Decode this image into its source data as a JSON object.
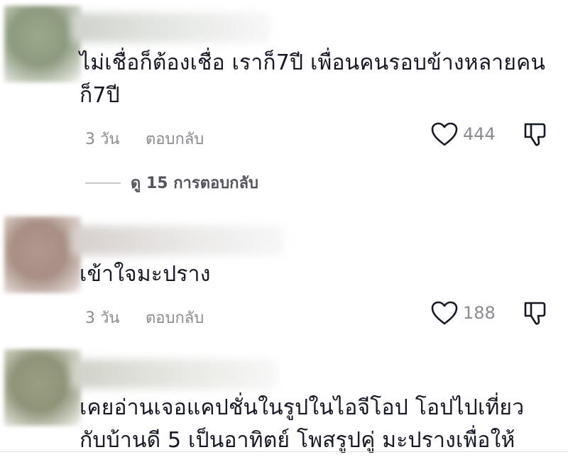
{
  "comments": [
    {
      "text_lines": [
        "ไม่เชื่อก็ต้องเชื่อ เราก็7ปี เพื่อนคนรอบข้างหลายคน",
        "ก็7ปี"
      ],
      "time": "3 วัน",
      "reply_label": "ตอบกลับ",
      "likes": "444",
      "view_replies": "ดู 15 การตอบกลับ",
      "avatar_color": "#8c9a7e"
    },
    {
      "text_lines": [
        "เข้าใจมะปราง"
      ],
      "time": "3 วัน",
      "reply_label": "ตอบกลับ",
      "likes": "188",
      "avatar_color": "#a88e84"
    },
    {
      "text_lines": [
        "เคยอ่านเจอแคปชั่นในรูปในไอจีโอป โอปไปเที่ยว",
        "กับบ้านดี 5 เป็นอาทิตย์ โพสรูปคู่ มะปรางเพื่อให้"
      ],
      "avatar_color": "#8f9478"
    }
  ],
  "icons": {
    "like": "heart-outline-icon",
    "dislike": "thumbs-down-outline-icon"
  },
  "colors": {
    "text": "#161823",
    "meta": "#8a8b91",
    "icon": "#161823"
  }
}
